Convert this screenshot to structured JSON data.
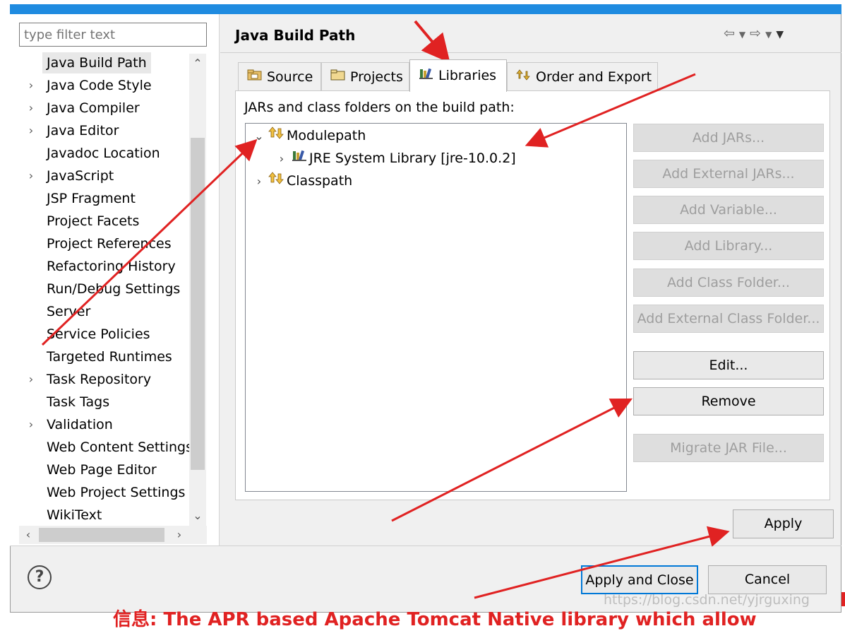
{
  "filter": {
    "placeholder": "type filter text"
  },
  "sidebar": {
    "items": [
      {
        "label": "Java Build Path",
        "has_children": false,
        "selected": true
      },
      {
        "label": "Java Code Style",
        "has_children": true
      },
      {
        "label": "Java Compiler",
        "has_children": true
      },
      {
        "label": "Java Editor",
        "has_children": true
      },
      {
        "label": "Javadoc Location",
        "has_children": false
      },
      {
        "label": "JavaScript",
        "has_children": true
      },
      {
        "label": "JSP Fragment",
        "has_children": false
      },
      {
        "label": "Project Facets",
        "has_children": false
      },
      {
        "label": "Project References",
        "has_children": false
      },
      {
        "label": "Refactoring History",
        "has_children": false
      },
      {
        "label": "Run/Debug Settings",
        "has_children": false
      },
      {
        "label": "Server",
        "has_children": false
      },
      {
        "label": "Service Policies",
        "has_children": false
      },
      {
        "label": "Targeted Runtimes",
        "has_children": false
      },
      {
        "label": "Task Repository",
        "has_children": true
      },
      {
        "label": "Task Tags",
        "has_children": false
      },
      {
        "label": "Validation",
        "has_children": true
      },
      {
        "label": "Web Content Settings",
        "has_children": false
      },
      {
        "label": "Web Page Editor",
        "has_children": false
      },
      {
        "label": "Web Project Settings",
        "has_children": false
      },
      {
        "label": "WikiText",
        "has_children": false
      }
    ]
  },
  "page": {
    "title": "Java Build Path"
  },
  "tabs": [
    {
      "label": "Source",
      "icon": "source-folder-icon",
      "active": false
    },
    {
      "label": "Projects",
      "icon": "projects-folder-icon",
      "active": false
    },
    {
      "label": "Libraries",
      "icon": "libraries-icon",
      "active": true
    },
    {
      "label": "Order and Export",
      "icon": "order-export-icon",
      "active": false
    }
  ],
  "build_path": {
    "label": "JARs and class folders on the build path:",
    "tree": [
      {
        "label": "Modulepath",
        "expanded": true,
        "level": 0,
        "icon": "modulepath-icon"
      },
      {
        "label": "JRE System Library [jre-10.0.2]",
        "expanded": false,
        "level": 1,
        "icon": "jre-library-icon",
        "selected": true
      },
      {
        "label": "Classpath",
        "expanded": false,
        "level": 0,
        "icon": "classpath-icon"
      }
    ]
  },
  "buttons": [
    {
      "label": "Add JARs...",
      "enabled": false
    },
    {
      "label": "Add External JARs...",
      "enabled": false
    },
    {
      "label": "Add Variable...",
      "enabled": false
    },
    {
      "label": "Add Library...",
      "enabled": false
    },
    {
      "label": "Add Class Folder...",
      "enabled": false
    },
    {
      "label": "Add External Class Folder...",
      "enabled": false
    },
    {
      "label": "Edit...",
      "enabled": true
    },
    {
      "label": "Remove",
      "enabled": true
    },
    {
      "label": "Migrate JAR File...",
      "enabled": false
    }
  ],
  "footer": {
    "apply_label": "Apply",
    "apply_close_label": "Apply and Close",
    "cancel_label": "Cancel",
    "help_label": "?"
  },
  "watermark": "https://blog.csdn.net/yjrguxing",
  "background_text": "信息: The APR based Apache Tomcat Native library which allow",
  "colors": {
    "annotation": "#e02222",
    "selection": "#cce8ff",
    "focus": "#0078d7"
  }
}
